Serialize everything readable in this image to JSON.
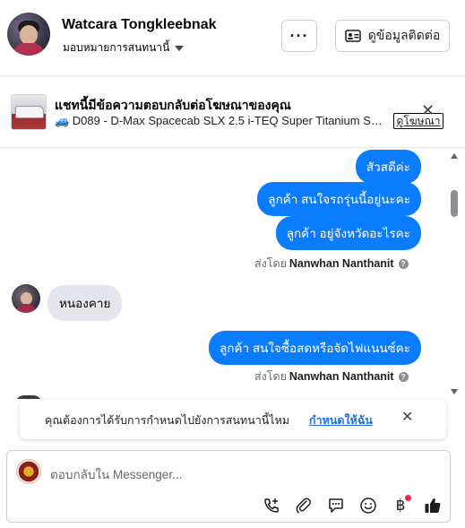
{
  "header": {
    "contact_name": "Watcara Tongkleebnak",
    "assign_label": "มอบหมายการสนทนานี้",
    "more_label": "···",
    "contact_info_label": "ดูข้อมูลติดต่อ"
  },
  "ad_banner": {
    "title": "แชทนี้มีข้อความตอบกลับต่อโฆษณาของคุณ",
    "subtitle": "🚙 D089 - D-Max Spacecab SLX 2.5 i-TEQ Super Titanium Speed ...",
    "view_ad_label": "ดูโฆษณา",
    "close_label": "✕"
  },
  "messages": {
    "out_group_1": [
      "สัวสดีค่ะ",
      "ลูกค้า สนใจรถรุ่นนี้อยู่นะคะ",
      "ลูกค้า อยู่จังหวัดอะไรคะ"
    ],
    "sent_by_1_prefix": "ส่งโดย",
    "sent_by_1_name": "Nanwhan Nanthanit",
    "in_message_1": "หนองคาย",
    "out_group_2": [
      "ลูกค้า สนใจซื้อสดหรือจัดไฟแนนซ์คะ"
    ],
    "sent_by_2_prefix": "ส่งโดย",
    "sent_by_2_name": "Nanwhan Nanthanit",
    "info_glyph": "?"
  },
  "notification": {
    "text": "คุณต้องการได้รับการกำหนดไปยังการสนทนานี้ไหม",
    "link": "กำหนดให้ฉัน",
    "close_label": "✕"
  },
  "composer": {
    "placeholder": "ตอบกลับใน Messenger...",
    "baht_glyph": "฿"
  },
  "colors": {
    "accent": "#0a7cff",
    "link": "#216fdb",
    "incoming_bubble": "#e4e6eb",
    "notification_dot": "#f02849"
  },
  "icons": [
    "more-icon",
    "contact-card-icon",
    "close-icon",
    "info-icon",
    "add-call-icon",
    "attachment-icon",
    "saved-reply-icon",
    "emoji-icon",
    "baht-payment-icon",
    "thumbs-up-icon"
  ]
}
